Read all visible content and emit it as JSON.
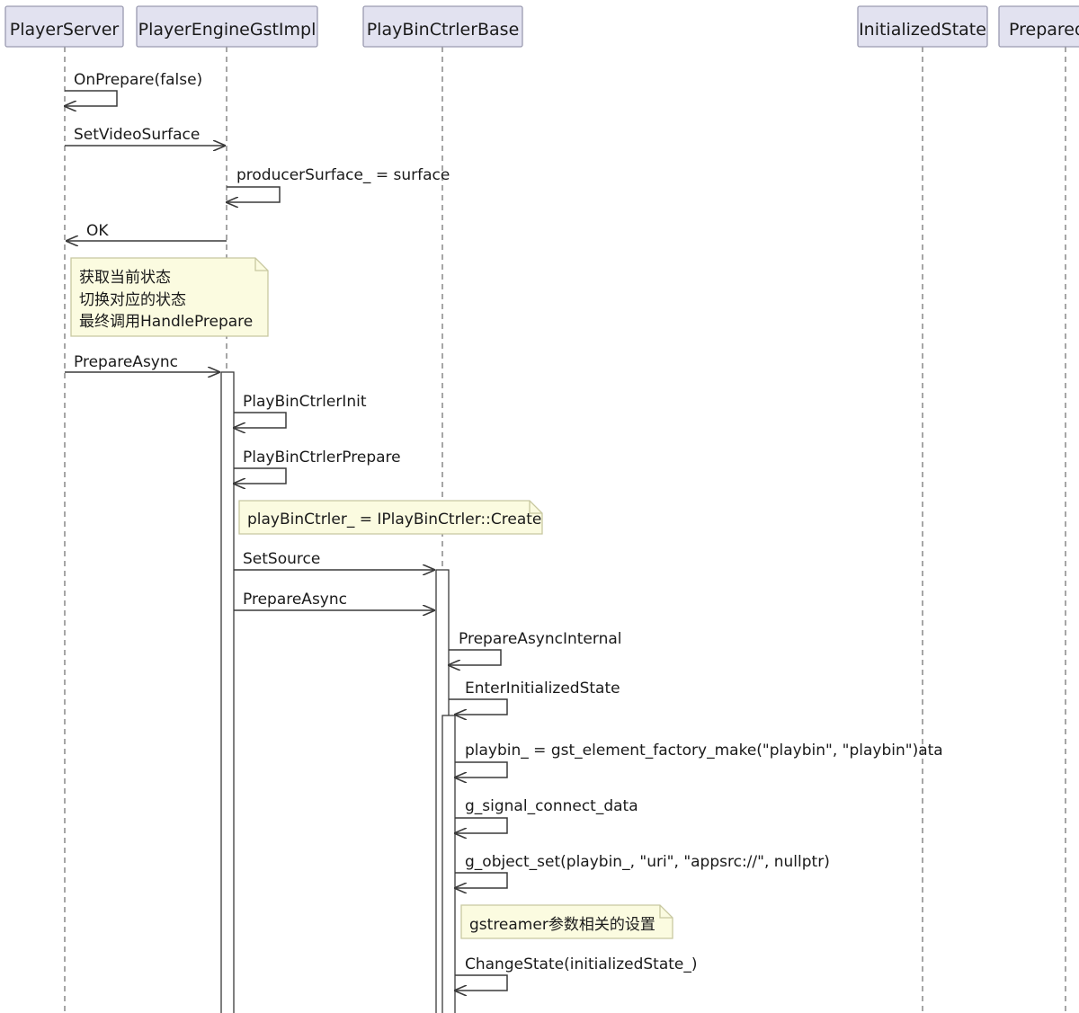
{
  "participants": [
    {
      "id": "ps",
      "label": "PlayerServer"
    },
    {
      "id": "pe",
      "label": "PlayerEngineGstImpl"
    },
    {
      "id": "pb",
      "label": "PlayBinCtrlerBase"
    },
    {
      "id": "is",
      "label": "InitializedState"
    },
    {
      "id": "pr",
      "label": "Prepared"
    }
  ],
  "messages": [
    {
      "from": "ps",
      "to": "ps",
      "label": "OnPrepare(false)"
    },
    {
      "from": "ps",
      "to": "pe",
      "label": "SetVideoSurface"
    },
    {
      "from": "pe",
      "to": "pe",
      "label": "producerSurface_ = surface"
    },
    {
      "from": "pe",
      "to": "ps",
      "label": "OK"
    },
    {
      "from": "ps",
      "to": "pe",
      "label": "PrepareAsync"
    },
    {
      "from": "pe",
      "to": "pe",
      "label": "PlayBinCtrlerInit"
    },
    {
      "from": "pe",
      "to": "pe",
      "label": "PlayBinCtrlerPrepare"
    },
    {
      "from": "pe",
      "to": "pb",
      "label": "SetSource"
    },
    {
      "from": "pe",
      "to": "pb",
      "label": "PrepareAsync"
    },
    {
      "from": "pb",
      "to": "pb",
      "label": "PrepareAsyncInternal"
    },
    {
      "from": "pb",
      "to": "pb",
      "label": "EnterInitializedState"
    },
    {
      "from": "pb",
      "to": "pb",
      "label": "playbin_ = gst_element_factory_make(\"playbin\", \"playbin\")ata"
    },
    {
      "from": "pb",
      "to": "pb",
      "label": "g_signal_connect_data"
    },
    {
      "from": "pb",
      "to": "pb",
      "label": "g_object_set(playbin_, \"uri\", \"appsrc://\", nullptr)"
    },
    {
      "from": "pb",
      "to": "pb",
      "label": "ChangeState(initializedState_)"
    }
  ],
  "notes": [
    {
      "lines": [
        "获取当前状态",
        "切换对应的状态",
        "最终调用HandlePrepare"
      ]
    },
    {
      "lines": [
        "playBinCtrler_ = IPlayBinCtrler::Create"
      ]
    },
    {
      "lines": [
        "gstreamer参数相关的设置"
      ]
    }
  ],
  "colors": {
    "participant_fill": "#e2e2f0",
    "participant_border": "#9a9ab0",
    "note_fill": "#fbfbe0",
    "note_border": "#c8c8a0",
    "line": "#3a3a3a",
    "lifeline": "#777777"
  }
}
